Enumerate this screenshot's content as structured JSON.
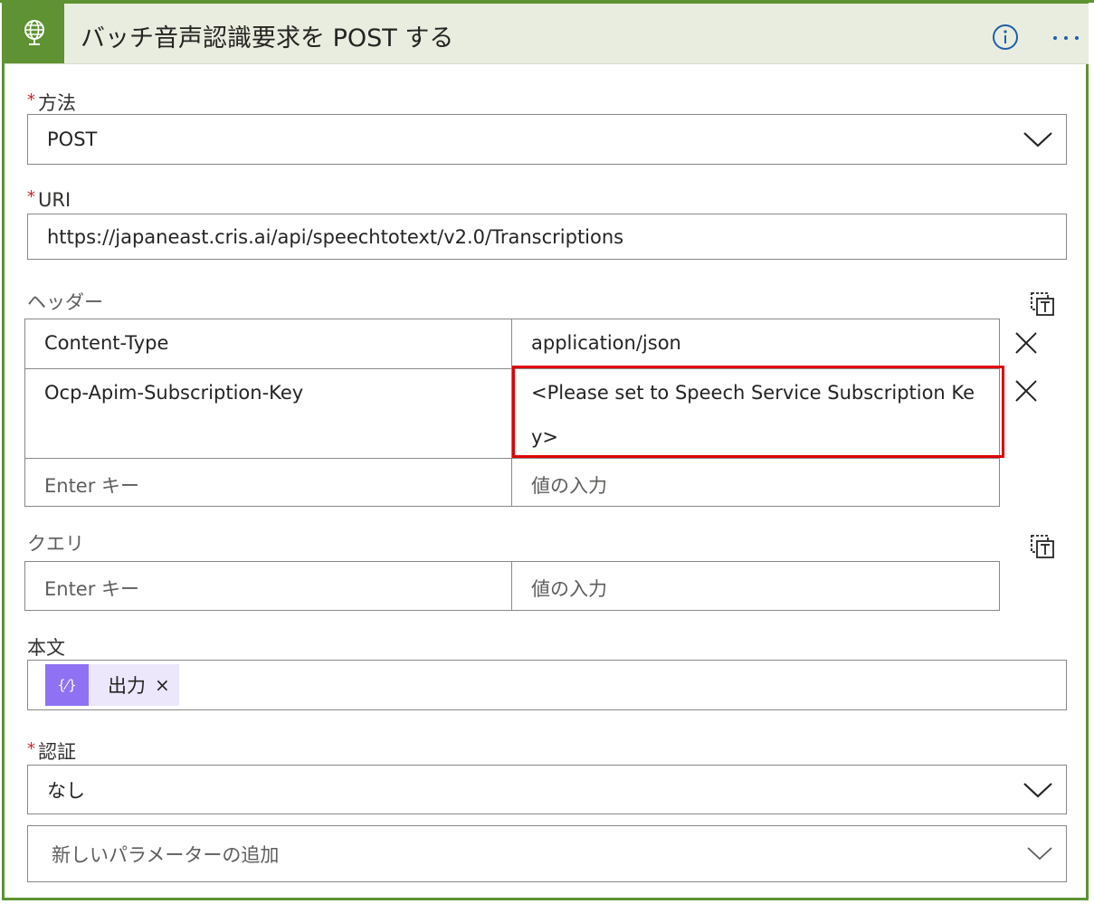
{
  "header": {
    "title": "バッチ音声認識要求を POST する"
  },
  "method": {
    "label": "方法",
    "required_mark": "*",
    "value": "POST"
  },
  "uri": {
    "label": "URI",
    "required_mark": "*",
    "value": "https://japaneast.cris.ai/api/speechtotext/v2.0/Transcriptions"
  },
  "headers": {
    "label": "ヘッダー",
    "rows": [
      {
        "key": "Content-Type",
        "value": "application/json"
      },
      {
        "key": "Ocp-Apim-Subscription-Key",
        "value": "<Please set to Speech Service Subscription Ke",
        "value_wrap": "y>"
      }
    ],
    "key_placeholder": "Enter キー",
    "value_placeholder": "値の入力"
  },
  "query": {
    "label": "クエリ",
    "key_placeholder": "Enter キー",
    "value_placeholder": "値の入力"
  },
  "body": {
    "label": "本文",
    "token_label": "出力",
    "token_remove": "×"
  },
  "auth": {
    "label": "認証",
    "required_mark": "*",
    "value": "なし"
  },
  "add_param": {
    "placeholder": "新しいパラメーターの追加"
  },
  "colors": {
    "accent": "#5e9232",
    "header_bg": "#e9eddf",
    "required": "#c4262e",
    "token": "#8e72f3",
    "highlight": "#e00000"
  }
}
